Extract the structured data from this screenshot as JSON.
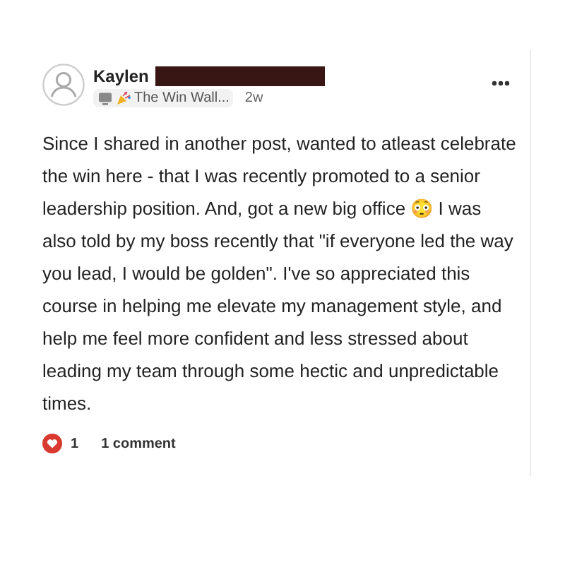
{
  "post": {
    "author": {
      "name": "Kaylen",
      "name_redacted": true
    },
    "category": "The Win Wall...",
    "time": "2w",
    "body": "Since I shared in another post, wanted to atleast celebrate the win here - that I was recently promoted to a senior leadership position. And, got a new big office 😳 I was also told by my boss recently that \"if everyone led the way you lead, I would be golden\". I've so appreciated this course in helping me elevate my management style, and help me feel more confident and less stressed about leading my team through some hectic and unpredictable times.",
    "likes": "1",
    "comments": "1 comment"
  }
}
